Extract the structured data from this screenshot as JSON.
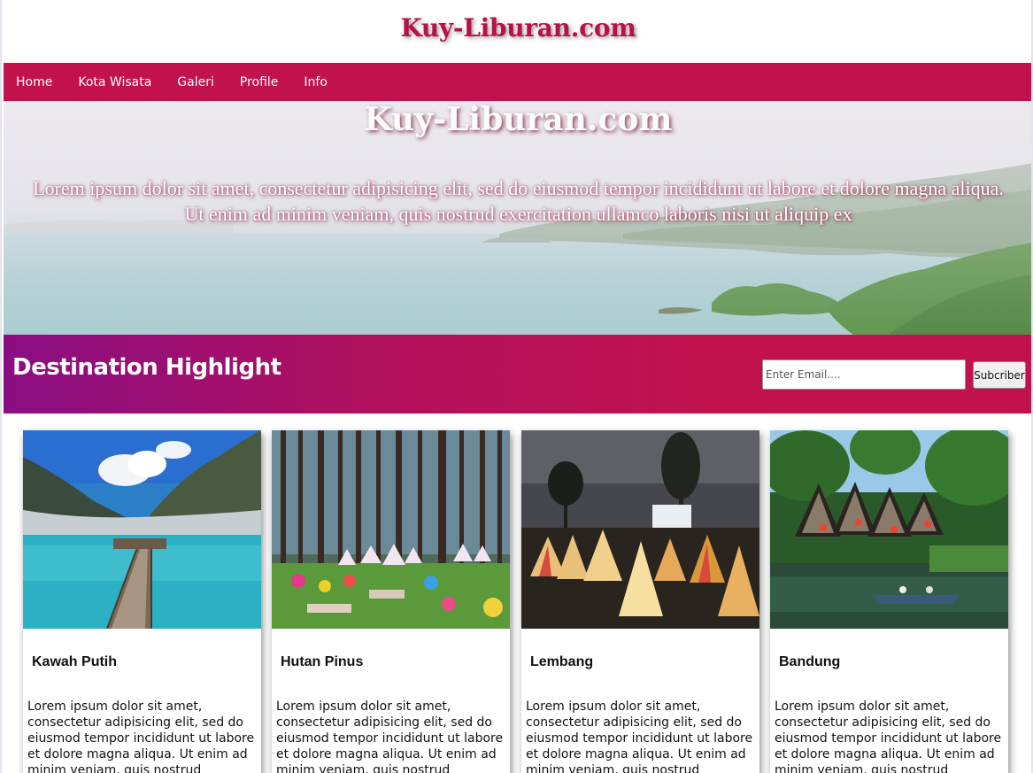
{
  "site": {
    "title": "Kuy-Liburan.com"
  },
  "nav": {
    "items": [
      {
        "label": "Home"
      },
      {
        "label": "Kota Wisata"
      },
      {
        "label": "Galeri"
      },
      {
        "label": "Profile"
      },
      {
        "label": "Info"
      }
    ]
  },
  "hero": {
    "title": "Kuy-Liburan.com",
    "text": "Lorem ipsum dolor sit amet, consectetur adipisicing elit, sed do eiusmod tempor incididunt ut labore et dolore magna aliqua. Ut enim ad minim veniam, quis nostrud exercitation ullamco laboris nisi ut aliquip ex"
  },
  "highlight": {
    "title": "Destination Highlight",
    "email_placeholder": "Enter Email....",
    "subscribe_label": "Subcriber"
  },
  "cards": [
    {
      "title": "Kawah Putih",
      "text": "Lorem ipsum dolor sit amet, consectetur adipisicing elit, sed do eiusmod tempor incididunt ut labore et dolore magna aliqua. Ut enim ad minim veniam, quis nostrud"
    },
    {
      "title": "Hutan Pinus",
      "text": "Lorem ipsum dolor sit amet, consectetur adipisicing elit, sed do eiusmod tempor incididunt ut labore et dolore magna aliqua. Ut enim ad minim veniam, quis nostrud"
    },
    {
      "title": "Lembang",
      "text": "Lorem ipsum dolor sit amet, consectetur adipisicing elit, sed do eiusmod tempor incididunt ut labore et dolore magna aliqua. Ut enim ad minim veniam, quis nostrud"
    },
    {
      "title": "Bandung",
      "text": "Lorem ipsum dolor sit amet, consectetur adipisicing elit, sed do eiusmod tempor incididunt ut labore et dolore magna aliqua. Ut enim ad minim veniam, quis nostrud"
    }
  ],
  "colors": {
    "brand": "#c2124d",
    "band_gradient_start": "#8a0e83",
    "title_red": "#b71245"
  }
}
